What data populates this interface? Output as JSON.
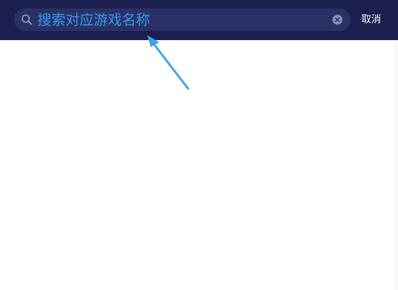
{
  "search": {
    "text": "搜索对应游戏名称"
  },
  "header": {
    "cancel_label": "取消"
  },
  "icons": {
    "search": "search-icon",
    "clear": "clear-circle-icon",
    "arrow": "arrow-annotation-icon"
  },
  "colors": {
    "topbar": "#1b1f4e",
    "search_field": "#2b3166",
    "search_text": "#2f9bf0",
    "arrow": "#3aa3ee"
  }
}
